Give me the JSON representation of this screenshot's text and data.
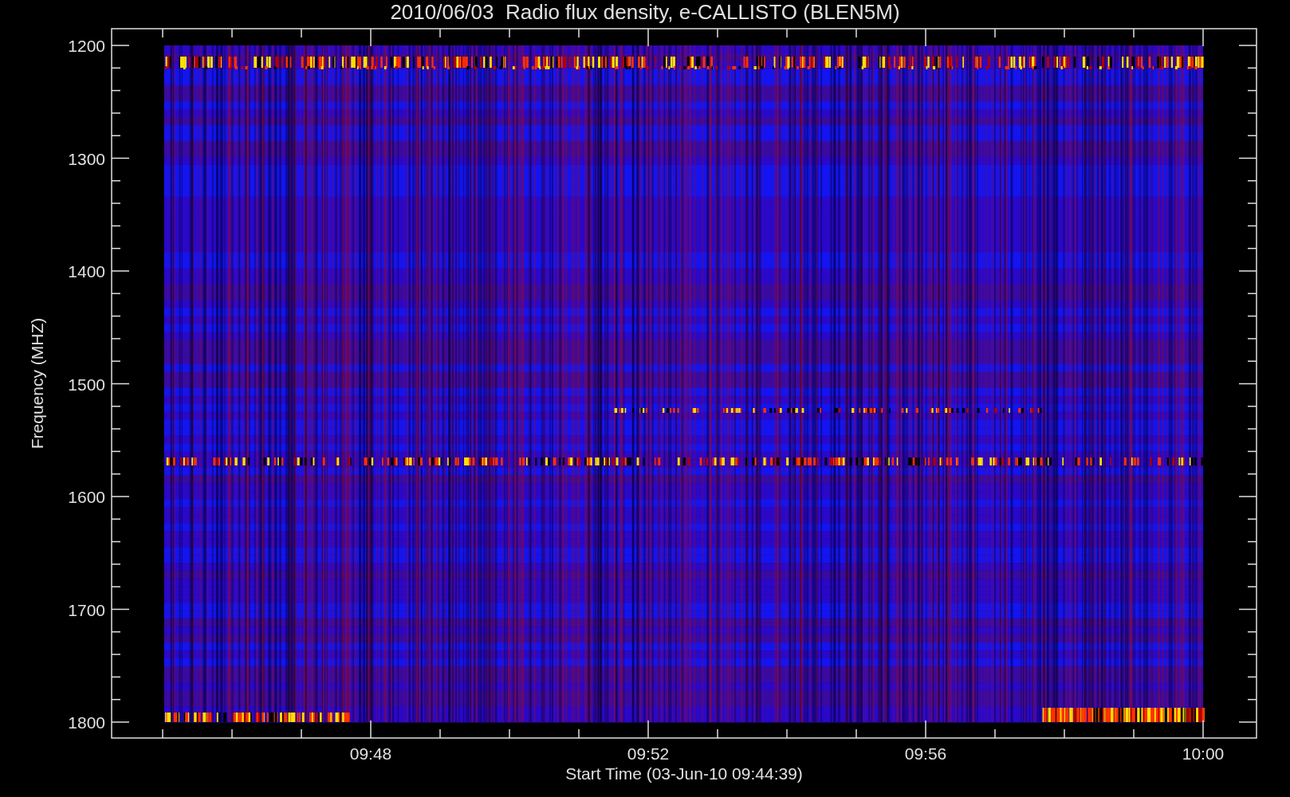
{
  "title": "2010/06/03  Radio flux density, e-CALLISTO (BLEN5M)",
  "y_axis": {
    "label": "Frequency (MHZ)",
    "ticks": [
      "1200",
      "1300",
      "1400",
      "1500",
      "1600",
      "1700",
      "1800"
    ]
  },
  "x_axis": {
    "label": "Start Time (03-Jun-10 09:44:39)",
    "ticks": [
      "09:48",
      "09:52",
      "09:56",
      "10:00"
    ]
  }
}
